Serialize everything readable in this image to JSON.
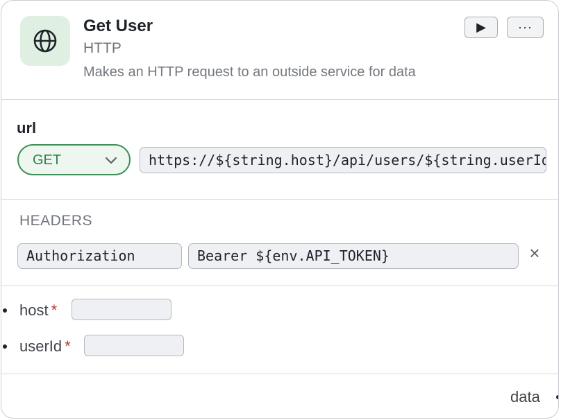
{
  "node": {
    "title": "Get User",
    "type": "HTTP",
    "description": "Makes an HTTP request to an outside service for data",
    "icon": "globe-icon",
    "accent_color": "#3d8f57",
    "icon_bg_color": "#dff0e3"
  },
  "toolbar": {
    "run_label": "▶",
    "more_label": "···"
  },
  "url_section": {
    "label": "url",
    "method": "GET",
    "url_value": "https://${string.host}/api/users/${string.userId}"
  },
  "headers_section": {
    "label": "HEADERS",
    "items": [
      {
        "key": "Authorization",
        "value": "Bearer ${env.API_TOKEN}",
        "remove_label": "×"
      }
    ]
  },
  "inputs": [
    {
      "label": "host",
      "required_mark": "*",
      "value": ""
    },
    {
      "label": "userId",
      "required_mark": "*",
      "value": ""
    }
  ],
  "outputs": [
    {
      "label": "data"
    }
  ]
}
